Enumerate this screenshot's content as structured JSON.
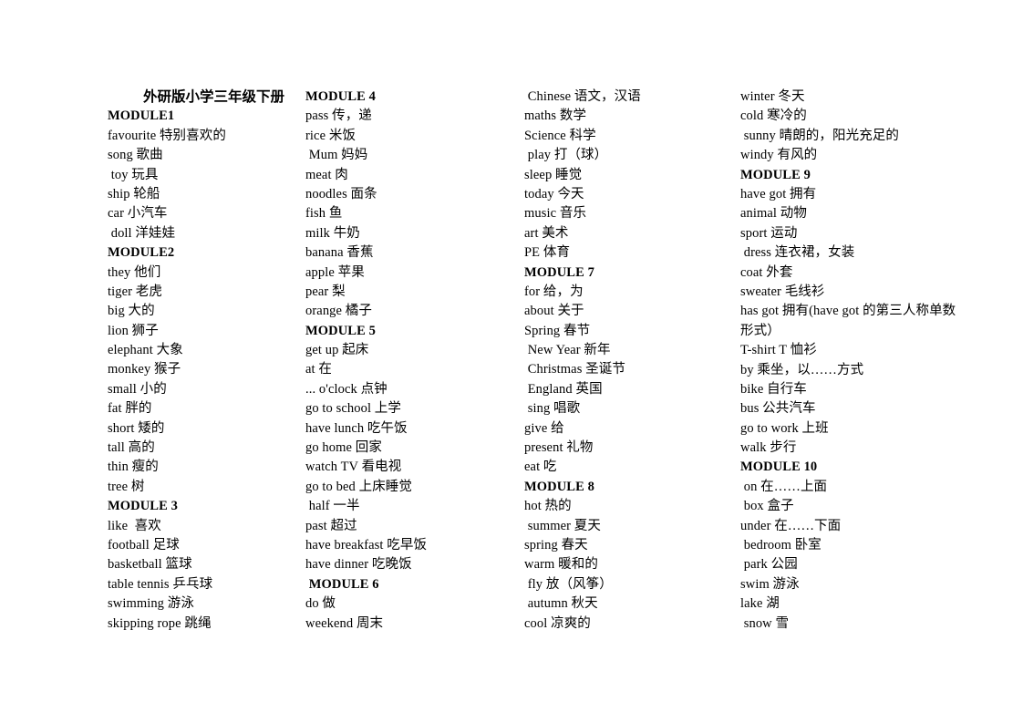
{
  "document": {
    "title": "外研版小学三年级下册"
  },
  "columns": [
    {
      "name": "column-1",
      "lines": [
        {
          "text": "外研版小学三年级下册",
          "style": "title"
        },
        {
          "text": "MODULE1",
          "style": "module"
        },
        {
          "text": "favourite 特别喜欢的",
          "style": "entry"
        },
        {
          "text": "song 歌曲",
          "style": "entry"
        },
        {
          "text": " toy 玩具",
          "style": "entry"
        },
        {
          "text": "ship 轮船",
          "style": "entry"
        },
        {
          "text": "car 小汽车",
          "style": "entry"
        },
        {
          "text": " doll 洋娃娃",
          "style": "entry"
        },
        {
          "text": "MODULE2",
          "style": "module"
        },
        {
          "text": "they 他们",
          "style": "entry"
        },
        {
          "text": "tiger 老虎",
          "style": "entry"
        },
        {
          "text": "big 大的",
          "style": "entry"
        },
        {
          "text": "lion 狮子",
          "style": "entry"
        },
        {
          "text": "elephant 大象",
          "style": "entry"
        },
        {
          "text": "monkey 猴子",
          "style": "entry"
        },
        {
          "text": "small 小的",
          "style": "entry"
        },
        {
          "text": "fat 胖的",
          "style": "entry"
        },
        {
          "text": "short 矮的",
          "style": "entry"
        },
        {
          "text": "tall 高的",
          "style": "entry"
        },
        {
          "text": "thin 瘦的",
          "style": "entry"
        },
        {
          "text": "tree 树",
          "style": "entry"
        },
        {
          "text": "MODULE 3",
          "style": "module"
        },
        {
          "text": "like  喜欢",
          "style": "entry"
        },
        {
          "text": "football 足球",
          "style": "entry"
        },
        {
          "text": "basketball 篮球",
          "style": "entry"
        },
        {
          "text": "table tennis 乒乓球",
          "style": "entry"
        },
        {
          "text": "swimming 游泳",
          "style": "entry"
        },
        {
          "text": "skipping rope 跳绳",
          "style": "entry"
        }
      ]
    },
    {
      "name": "column-2",
      "lines": [
        {
          "text": "MODULE 4",
          "style": "module"
        },
        {
          "text": "pass 传，递",
          "style": "entry"
        },
        {
          "text": "rice 米饭",
          "style": "entry"
        },
        {
          "text": " Mum 妈妈",
          "style": "entry"
        },
        {
          "text": "meat 肉",
          "style": "entry"
        },
        {
          "text": "noodles 面条",
          "style": "entry"
        },
        {
          "text": "fish 鱼",
          "style": "entry"
        },
        {
          "text": "milk 牛奶",
          "style": "entry"
        },
        {
          "text": "banana 香蕉",
          "style": "entry"
        },
        {
          "text": "apple 苹果",
          "style": "entry"
        },
        {
          "text": "pear 梨",
          "style": "entry"
        },
        {
          "text": "orange 橘子",
          "style": "entry"
        },
        {
          "text": "MODULE 5",
          "style": "module"
        },
        {
          "text": "get up 起床",
          "style": "entry"
        },
        {
          "text": "at 在",
          "style": "entry"
        },
        {
          "text": "... o'clock 点钟",
          "style": "entry"
        },
        {
          "text": "go to school 上学",
          "style": "entry"
        },
        {
          "text": "have lunch 吃午饭",
          "style": "entry"
        },
        {
          "text": "go home 回家",
          "style": "entry"
        },
        {
          "text": "watch TV 看电视",
          "style": "entry"
        },
        {
          "text": "go to bed 上床睡觉",
          "style": "entry"
        },
        {
          "text": " half 一半",
          "style": "entry"
        },
        {
          "text": "past 超过",
          "style": "entry"
        },
        {
          "text": "have breakfast 吃早饭",
          "style": "entry"
        },
        {
          "text": "have dinner 吃晚饭",
          "style": "entry"
        },
        {
          "text": " MODULE 6",
          "style": "module"
        },
        {
          "text": "do 做",
          "style": "entry"
        },
        {
          "text": "weekend 周末",
          "style": "entry"
        }
      ]
    },
    {
      "name": "column-3",
      "lines": [
        {
          "text": " Chinese 语文，汉语",
          "style": "entry"
        },
        {
          "text": "maths 数学",
          "style": "entry"
        },
        {
          "text": "Science 科学",
          "style": "entry"
        },
        {
          "text": " play 打（球）",
          "style": "entry"
        },
        {
          "text": "sleep 睡觉",
          "style": "entry"
        },
        {
          "text": "today 今天",
          "style": "entry"
        },
        {
          "text": "music 音乐",
          "style": "entry"
        },
        {
          "text": "art 美术",
          "style": "entry"
        },
        {
          "text": "PE 体育",
          "style": "entry"
        },
        {
          "text": "MODULE 7",
          "style": "module"
        },
        {
          "text": "for 给，为",
          "style": "entry"
        },
        {
          "text": "about 关于",
          "style": "entry"
        },
        {
          "text": "Spring 春节",
          "style": "entry"
        },
        {
          "text": " New Year 新年",
          "style": "entry"
        },
        {
          "text": " Christmas 圣诞节",
          "style": "entry"
        },
        {
          "text": " England 英国",
          "style": "entry"
        },
        {
          "text": " sing 唱歌",
          "style": "entry"
        },
        {
          "text": "give 给",
          "style": "entry"
        },
        {
          "text": "present 礼物",
          "style": "entry"
        },
        {
          "text": "eat 吃",
          "style": "entry"
        },
        {
          "text": "MODULE 8",
          "style": "module"
        },
        {
          "text": "hot 热的",
          "style": "entry"
        },
        {
          "text": " summer 夏天",
          "style": "entry"
        },
        {
          "text": "spring 春天",
          "style": "entry"
        },
        {
          "text": "warm 暖和的",
          "style": "entry"
        },
        {
          "text": " fly 放（风筝）",
          "style": "entry"
        },
        {
          "text": " autumn 秋天",
          "style": "entry"
        },
        {
          "text": "cool 凉爽的",
          "style": "entry"
        }
      ]
    },
    {
      "name": "column-4",
      "lines": [
        {
          "text": "winter 冬天",
          "style": "entry"
        },
        {
          "text": "cold 寒冷的",
          "style": "entry"
        },
        {
          "text": " sunny 晴朗的，阳光充足的",
          "style": "entry"
        },
        {
          "text": "windy 有风的",
          "style": "entry"
        },
        {
          "text": "MODULE 9",
          "style": "module"
        },
        {
          "text": "have got 拥有",
          "style": "entry"
        },
        {
          "text": "animal 动物",
          "style": "entry"
        },
        {
          "text": "sport 运动",
          "style": "entry"
        },
        {
          "text": " dress 连衣裙，女装",
          "style": "entry"
        },
        {
          "text": "coat 外套",
          "style": "entry"
        },
        {
          "text": "sweater 毛线衫",
          "style": "entry"
        },
        {
          "text": "has got 拥有(have got 的第三人称单数形式）",
          "style": "entry-wrap"
        },
        {
          "text": "T-shirt T 恤衫",
          "style": "entry"
        },
        {
          "text": "by 乘坐，以……方式",
          "style": "entry"
        },
        {
          "text": "bike 自行车",
          "style": "entry"
        },
        {
          "text": "bus 公共汽车",
          "style": "entry"
        },
        {
          "text": "go to work 上班",
          "style": "entry"
        },
        {
          "text": "walk 步行",
          "style": "entry"
        },
        {
          "text": "MODULE 10",
          "style": "module"
        },
        {
          "text": " on 在……上面",
          "style": "entry"
        },
        {
          "text": " box 盒子",
          "style": "entry"
        },
        {
          "text": "under 在……下面",
          "style": "entry"
        },
        {
          "text": " bedroom 卧室",
          "style": "entry"
        },
        {
          "text": " park 公园",
          "style": "entry"
        },
        {
          "text": "swim 游泳",
          "style": "entry"
        },
        {
          "text": "lake 湖",
          "style": "entry"
        },
        {
          "text": " snow 雪",
          "style": "entry"
        }
      ]
    }
  ]
}
